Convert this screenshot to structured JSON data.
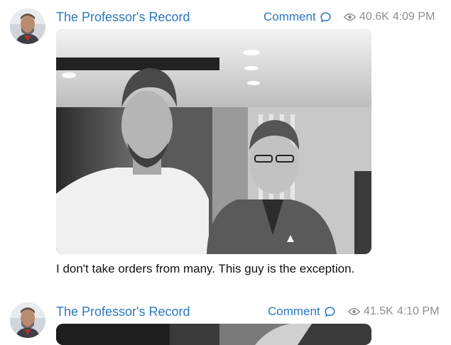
{
  "posts": [
    {
      "channel_name": "The Professor's Record",
      "comment_label": "Comment",
      "views": "40.6K",
      "time": "4:09 PM",
      "caption": "I don't take orders from many.  This guy is the exception.",
      "photo_desc": "black-and-white photo of two men standing together indoors"
    },
    {
      "channel_name": "The Professor's Record",
      "comment_label": "Comment",
      "views": "41.5K",
      "time": "4:10 PM"
    }
  ],
  "colors": {
    "link": "#2a78c2",
    "meta": "#8b8f95",
    "text": "#111111",
    "background": "#ffffff"
  },
  "icons": {
    "comment": "comment-bubble-icon",
    "views": "eye-icon"
  }
}
